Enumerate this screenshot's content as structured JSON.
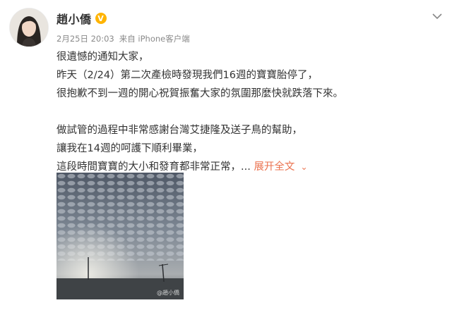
{
  "post": {
    "username": "趙小僑",
    "verified_badge": "V",
    "date": "2月25日 20:03",
    "source": "来自 iPhone客户端",
    "lines": [
      "很遺憾的通知大家，",
      "昨天（2/24）第二次產檢時發現我們16週的寶寶胎停了，",
      "很抱歉不到一週的開心祝賀振奮大家的氛圍那麼快就跌落下來。",
      "做試管的過程中非常感謝台灣艾捷隆及送子鳥的幫助，",
      "讓我在14週的呵護下順利畢業，",
      "這段時間寶寶的大小和發育都非常正常，..."
    ],
    "expand_label": "展开全文",
    "photo_watermark": "@趙小僑"
  },
  "icons": {
    "verified": "verified-v-icon",
    "dropdown": "chevron-down-icon",
    "expand": "chevron-down-icon"
  },
  "colors": {
    "accent": "#eb7350",
    "verified": "#ffb400",
    "meta": "#8a8a8a",
    "text": "#333333"
  }
}
